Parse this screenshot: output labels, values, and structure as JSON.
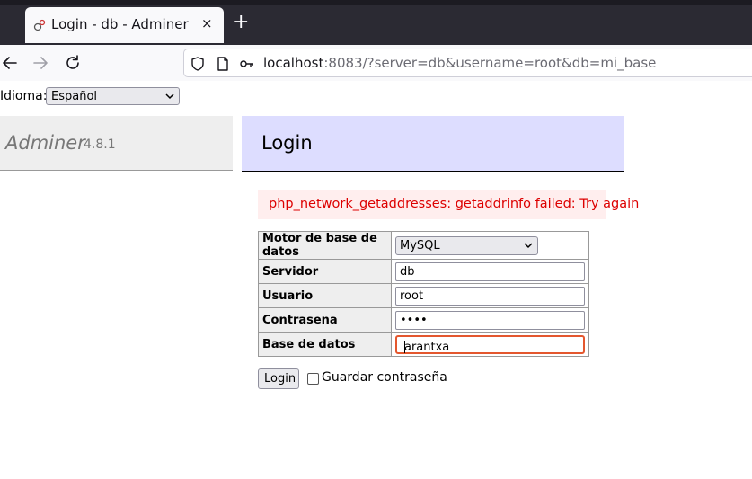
{
  "browser": {
    "tab_title": "Login - db - Adminer",
    "new_tab_glyph": "+",
    "close_glyph": "×",
    "url_host": "localhost",
    "url_rest": ":8083/?server=db&username=root&db=mi_base"
  },
  "language": {
    "label": "Idioma:",
    "selected": "Español"
  },
  "sidebar": {
    "brand": "Adminer",
    "version": "4.8.1"
  },
  "main": {
    "title": "Login",
    "error": "php_network_getaddresses: getaddrinfo failed: Try again"
  },
  "form": {
    "rows": [
      {
        "label": "Motor de base de datos",
        "value": "MySQL"
      },
      {
        "label": "Servidor",
        "value": "db"
      },
      {
        "label": "Usuario",
        "value": "root"
      },
      {
        "label": "Contraseña",
        "value": "••••"
      },
      {
        "label": "Base de datos",
        "value": "arantxa"
      }
    ],
    "submit_label": "Login",
    "remember_label": "Guardar contraseña"
  },
  "colors": {
    "tabstrip": "#2b2a33",
    "sidebar_bg": "#eeeeee",
    "header_bg": "#ddddff",
    "error_bg": "#ffeeee",
    "error_text": "#dd0000",
    "focus_ring": "#e4572e"
  },
  "icons": [
    "favicon-icon",
    "close-icon",
    "plus-icon",
    "back-icon",
    "forward-icon",
    "reload-icon",
    "shield-icon",
    "page-icon",
    "key-icon",
    "chevron-down-icon"
  ]
}
